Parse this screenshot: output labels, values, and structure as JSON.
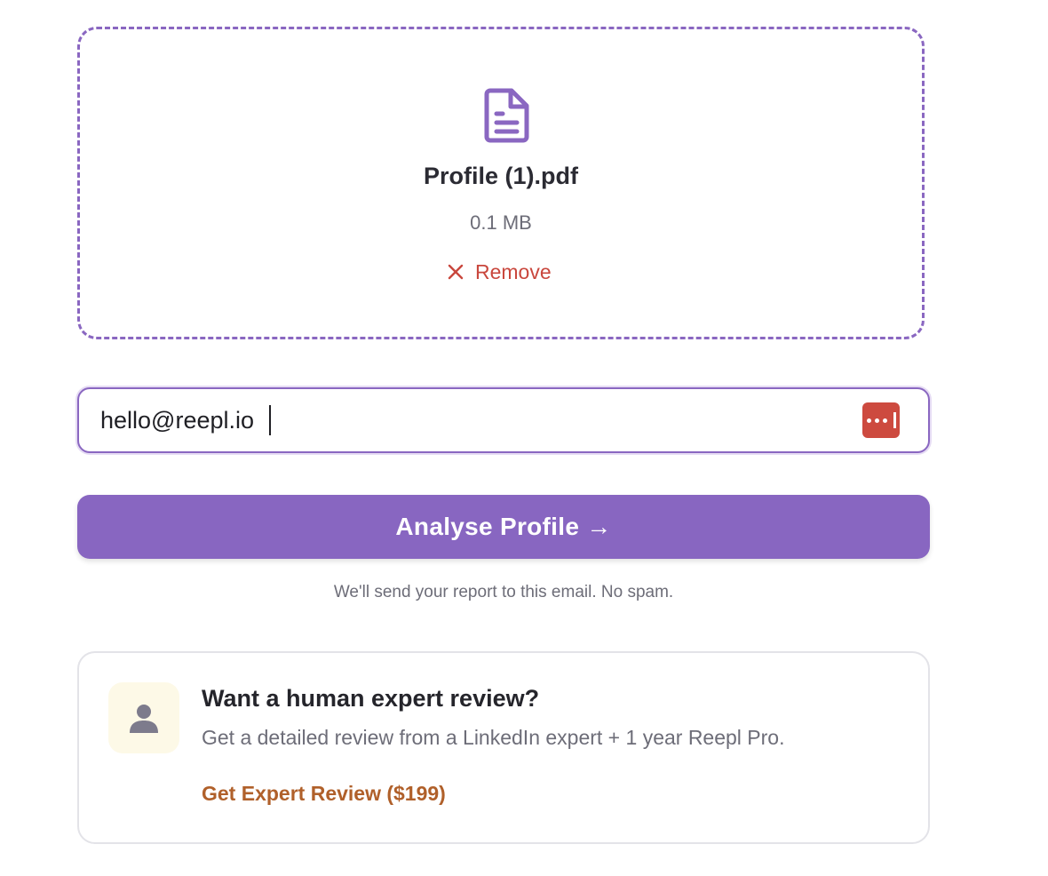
{
  "upload": {
    "file_icon": "document-icon",
    "file_name": "Profile (1).pdf",
    "file_size": "0.1 MB",
    "remove_icon": "close-icon",
    "remove_label": "Remove",
    "accent_color": "#8a67c1",
    "remove_color": "#c9473d"
  },
  "email": {
    "value": "hello@reepl.io",
    "password_manager_icon": "password-manager-icon"
  },
  "submit": {
    "label": "Analyse Profile →",
    "color": "#8866c1"
  },
  "helper_text": "We'll send your report to this email. No spam.",
  "expert": {
    "avatar_icon": "person-icon",
    "title": "Want a human expert review?",
    "description": "Get a detailed review from a LinkedIn expert + 1 year Reepl Pro.",
    "link_label": "Get Expert Review ($199)",
    "link_color": "#b0602a"
  }
}
